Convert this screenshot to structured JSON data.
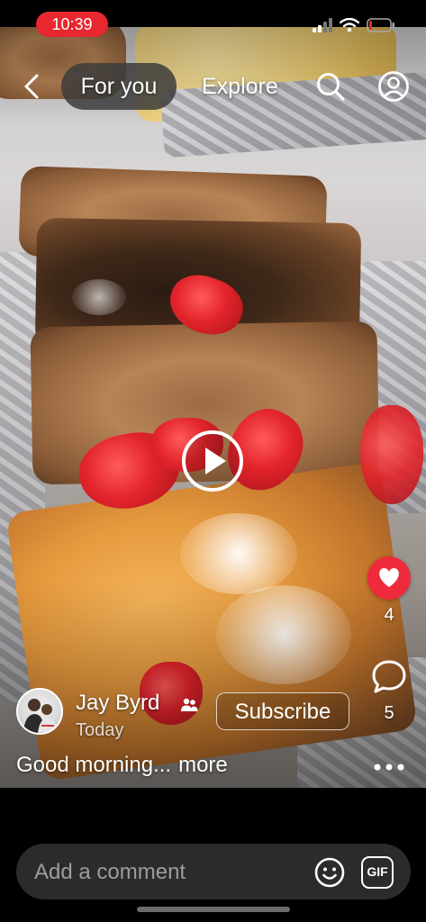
{
  "status_bar": {
    "time": "10:39",
    "time_pill_color": "#e8272f",
    "icons": [
      "signal-icon",
      "wifi-icon",
      "battery-icon"
    ]
  },
  "nav": {
    "back_icon": "chevron-left-icon",
    "tab_for_you": "For you",
    "tab_explore": "Explore",
    "active_tab": "For you",
    "search_icon": "search-icon",
    "profile_icon": "profile-icon"
  },
  "media": {
    "description_icon": "play-icon"
  },
  "actions": {
    "like_count": "4",
    "like_color": "#ee2b3d",
    "comment_count": "5"
  },
  "post": {
    "author": "Jay Byrd",
    "time": "Today",
    "subscribe_label": "Subscribe",
    "caption": "Good morning...",
    "more_label": "more"
  },
  "comment_bar": {
    "placeholder": "Add a comment",
    "gif_label": "GIF"
  }
}
